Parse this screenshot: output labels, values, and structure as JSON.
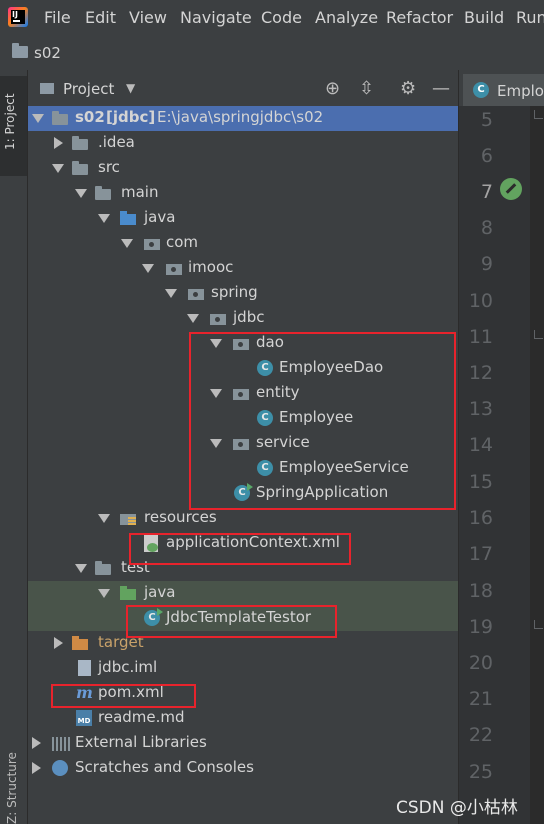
{
  "menu": [
    "File",
    "Edit",
    "View",
    "Navigate",
    "Code",
    "Analyze",
    "Refactor",
    "Build",
    "Run"
  ],
  "navbar": {
    "label": "s02"
  },
  "left_stripe": {
    "project": "1: Project",
    "structure": "Z: Structure"
  },
  "panel": {
    "title": "Project"
  },
  "tree": {
    "root": {
      "name": "s02",
      "module": "[jdbc]",
      "path": "E:\\java\\springjdbc\\s02"
    },
    "idea": ".idea",
    "src": "src",
    "main": "main",
    "java_main": "java",
    "com": "com",
    "imooc": "imooc",
    "spring": "spring",
    "jdbc": "jdbc",
    "dao": "dao",
    "employee_dao": "EmployeeDao",
    "entity": "entity",
    "employee": "Employee",
    "service": "service",
    "employee_service": "EmployeeService",
    "spring_application": "SpringApplication",
    "resources": "resources",
    "application_context": "applicationContext.xml",
    "test": "test",
    "java_test": "java",
    "jdbc_template_testor": "JdbcTemplateTestor",
    "target": "target",
    "jdbc_iml": "jdbc.iml",
    "pom": "pom.xml",
    "readme": "readme.md",
    "external_libraries": "External Libraries",
    "scratches": "Scratches and Consoles"
  },
  "editor": {
    "tab_label": "Employ",
    "line_numbers": [
      "5",
      "6",
      "7",
      "8",
      "9",
      "10",
      "11",
      "12",
      "13",
      "14",
      "15",
      "16",
      "17",
      "18",
      "19",
      "20",
      "21",
      "22",
      "25"
    ],
    "active_line": "7"
  },
  "watermark": "CSDN @小枯林",
  "colors": {
    "selection": "#4b6eaf",
    "annotation_red": "#e8232c",
    "background": "#3c3f41"
  }
}
